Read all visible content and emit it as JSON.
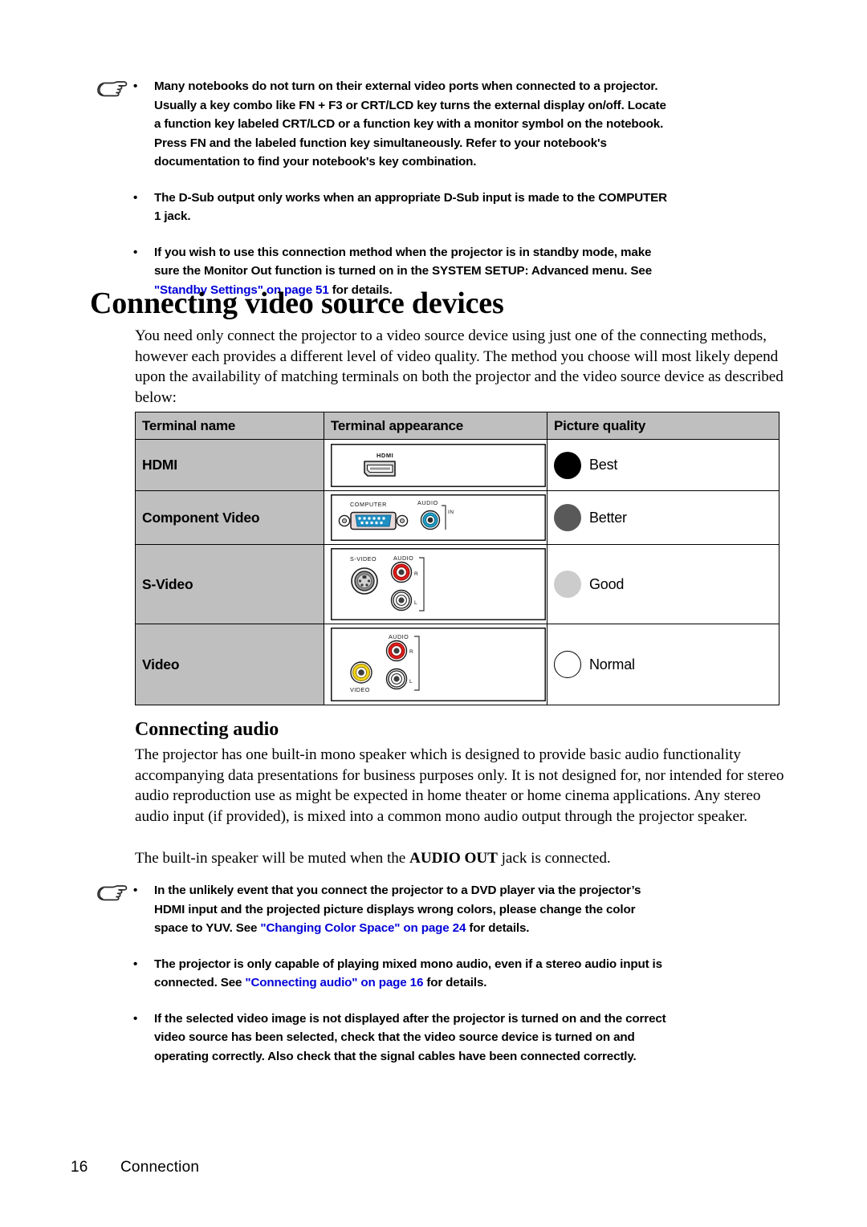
{
  "notes_top": {
    "items": [
      {
        "has_hand": true,
        "bullet": "•",
        "lines": [
          "Many notebooks do not turn on their external video ports when connected to a projector.",
          "Usually a key combo like FN + F3 or CRT/LCD key turns the external display on/off. Locate",
          "a function key labeled CRT/LCD or a function key with a monitor symbol on the notebook.",
          "Press FN and the labeled function key simultaneously. Refer to your notebook's",
          "documentation to find your notebook's key combination."
        ]
      },
      {
        "has_hand": false,
        "bullet": "•",
        "lines": [
          "The D-Sub output only works when an appropriate D-Sub input is made to the COMPUTER",
          "1 jack."
        ]
      },
      {
        "has_hand": false,
        "bullet": "•",
        "lines_rich": [
          {
            "text": "If you wish to use this connection method when the projector is in standby mode, make"
          },
          {
            "text": "sure the Monitor Out function is turned on in the SYSTEM SETUP: Advanced menu. See"
          },
          {
            "link": "\"Standby Settings\" on page 51",
            "text": " for details."
          }
        ]
      }
    ]
  },
  "heading_main": "Connecting video source devices",
  "intro_paragraph": "You need only connect the projector to a video source device using just one of the connecting methods, however each provides a different level of video quality. The method you choose will most likely depend upon the availability of matching terminals on both the projector and the video source device as described below:",
  "table": {
    "headers": [
      "Terminal name",
      "Terminal appearance",
      "Picture quality"
    ],
    "rows": [
      {
        "name": "HDMI",
        "appearance_icon": "hdmi-port-illustration",
        "appearance_labels": [
          "HDMI"
        ],
        "quality": "Best",
        "quality_dot": "black",
        "quality_color": "#000000"
      },
      {
        "name": "Component Video",
        "appearance_icon": "computer-dsub-and-audio-in-illustration",
        "appearance_labels": [
          "COMPUTER",
          "AUDIO",
          "IN"
        ],
        "quality": "Better",
        "quality_dot": "dark",
        "quality_color": "#595959"
      },
      {
        "name": "S-Video",
        "appearance_icon": "s-video-and-audio-rl-illustration",
        "appearance_labels": [
          "S-VIDEO",
          "AUDIO",
          "R",
          "L"
        ],
        "quality": "Good",
        "quality_dot": "light",
        "quality_color": "#cccccc"
      },
      {
        "name": "Video",
        "appearance_icon": "composite-video-and-audio-rl-illustration",
        "appearance_labels": [
          "AUDIO",
          "R",
          "L",
          "VIDEO"
        ],
        "quality": "Normal",
        "quality_dot": "white",
        "quality_color": "#ffffff"
      }
    ]
  },
  "heading_audio": "Connecting audio",
  "audio_paragraph": "The projector has one built-in mono speaker which is designed to provide basic audio functionality accompanying data presentations for business purposes only. It is not designed for, nor intended for stereo audio reproduction use as might be expected in home theater or home cinema applications. Any stereo audio input (if provided), is mixed into a common mono audio output through the projector speaker.",
  "audio_note": {
    "before": "The built-in speaker will be muted when the ",
    "bold": "AUDIO OUT",
    "after": " jack is connected."
  },
  "notes_bottom": {
    "items": [
      {
        "has_hand": true,
        "bullet": "•",
        "lines_rich": [
          {
            "text": "In the unlikely event that you connect the projector to a DVD player via the projector’s"
          },
          {
            "text": "HDMI input and the projected picture displays wrong colors, please change the color"
          },
          {
            "text": "space to YUV. See ",
            "link": "\"Changing Color Space\" on page 24",
            "text_after": " for details."
          }
        ]
      },
      {
        "has_hand": false,
        "bullet": "•",
        "lines_rich": [
          {
            "text": "The projector is only capable of playing mixed mono audio, even if a stereo audio input is"
          },
          {
            "text": "connected. See ",
            "link": "\"Connecting audio\" on page 16",
            "text_after": " for details."
          }
        ]
      },
      {
        "has_hand": false,
        "bullet": "•",
        "lines": [
          "If the selected video image is not displayed after the projector is turned on and the correct",
          "video source has been selected, check that the video source device is turned on and",
          "operating correctly. Also check that the signal cables have been connected correctly."
        ]
      }
    ]
  },
  "footer": {
    "page_number": "16",
    "section": "Connection"
  },
  "colors": {
    "link": "#0000d8",
    "table_header_bg": "#bfbfbf",
    "name_col_bg": "#bfbfbf",
    "vga_blue": "#1f8fc4",
    "audio_in_cyan": "#1d9fc9",
    "rca_red": "#e01b18",
    "rca_yellow": "#f2d318",
    "rca_white": "#ffffff"
  }
}
